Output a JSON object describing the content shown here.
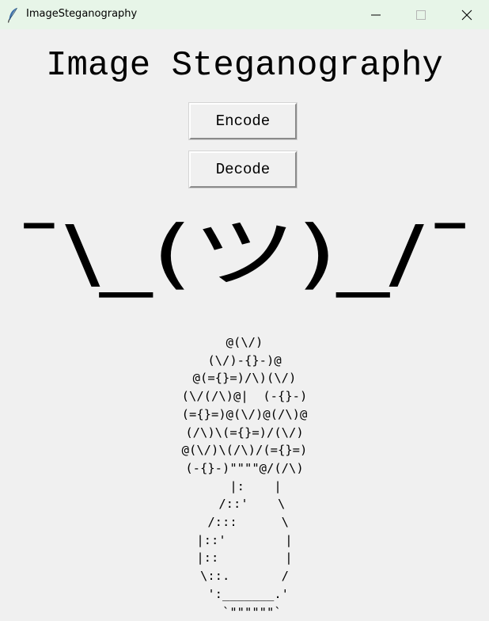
{
  "window": {
    "title": "ImageSteganography",
    "icons": {
      "app": "feather-icon",
      "minimize": "minimize-icon",
      "maximize": "maximize-icon",
      "close": "close-icon"
    }
  },
  "main": {
    "heading": "Image Steganography",
    "encode_label": "Encode",
    "decode_label": "Decode",
    "shrug_text": "¯\\_(ツ)_/¯",
    "flower_art": "@(\\/)\n(\\/)-{}-)@\n@(={}=)/\\)(\\/)\n(\\/(/\\)@|  (-{}-)\n(={}=)@(\\/)@(/\\)@\n(/\\)\\(={}=)/(\\/)\n@(\\/)\\(/\\)/(={}=)\n(-{}-)\"\"\"\"@/(/\\)\n   |:    |\n  /::'    \\\n /:::      \\\n|::'        |\n|::         |\n\\::.       /\n ':_______.'\n  `\"\"\"\"\"\"`"
  }
}
